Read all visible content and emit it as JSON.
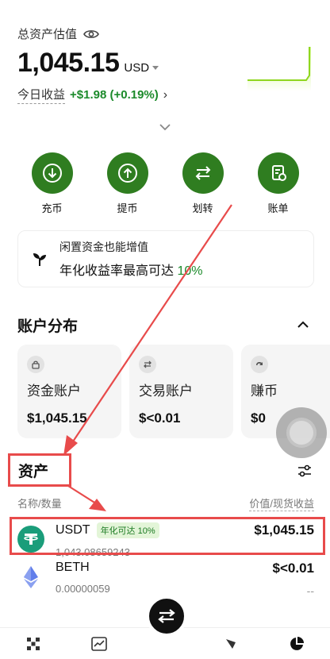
{
  "header": {
    "label": "总资产估值",
    "balance": "1,045.15",
    "currency": "USD",
    "pnl_label": "今日收益",
    "pnl_value": "+$1.98 (+0.19%)"
  },
  "actions": [
    {
      "label": "充币",
      "icon": "deposit-icon"
    },
    {
      "label": "提币",
      "icon": "withdraw-icon"
    },
    {
      "label": "划转",
      "icon": "transfer-icon"
    },
    {
      "label": "账单",
      "icon": "bill-icon"
    }
  ],
  "promo": {
    "line1": "闲置资金也能增值",
    "line2": "年化收益率最高可达",
    "highlight": "10%"
  },
  "distribution": {
    "title": "账户分布",
    "cards": [
      {
        "title": "资金账户",
        "value": "$1,045.15",
        "icon": "lock-icon"
      },
      {
        "title": "交易账户",
        "value": "$<0.01",
        "icon": "exchange-icon"
      },
      {
        "title": "赚币",
        "value": "$0",
        "icon": "earn-icon"
      }
    ]
  },
  "assets": {
    "title": "资产",
    "col_left": "名称/数量",
    "col_right": "价值/现货收益",
    "rows": [
      {
        "name": "USDT",
        "badge": "年化可达 10%",
        "qty": "1,043.08659243",
        "value": "$1,045.15",
        "pnl": "--"
      },
      {
        "name": "BETH",
        "badge": "",
        "qty": "0.00000059",
        "value": "$<0.01",
        "pnl": "--"
      }
    ]
  },
  "colors": {
    "accent": "#2f7d20",
    "positive": "#1b8a2a",
    "annotation": "#e84b4b"
  }
}
